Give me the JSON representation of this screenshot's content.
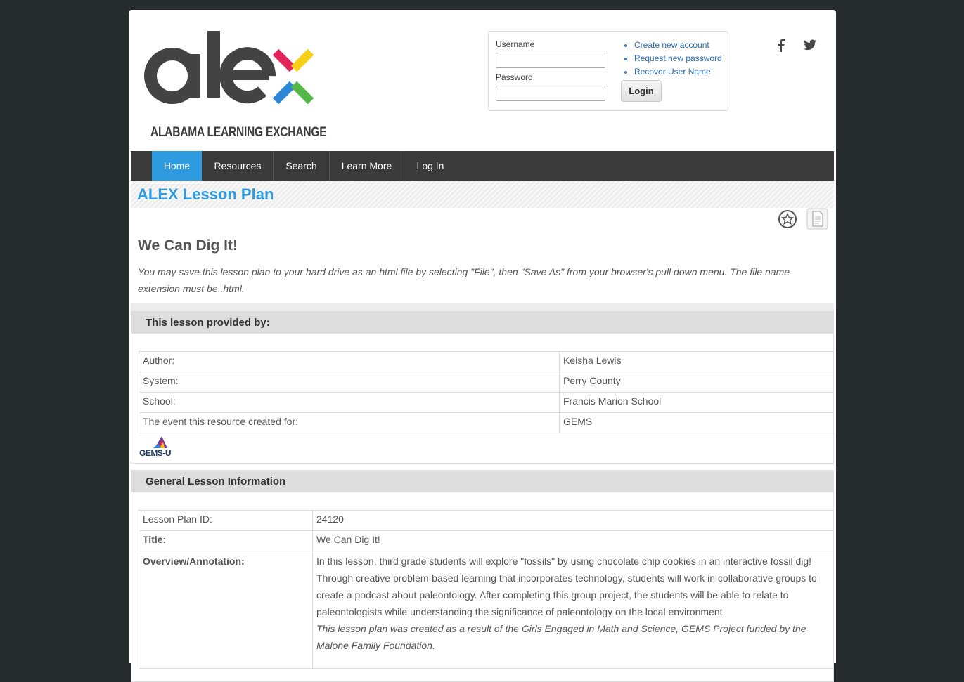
{
  "header": {
    "logo_tagline": "ALABAMA LEARNING EXCHANGE",
    "logo_word": "alex"
  },
  "login": {
    "username_label": "Username",
    "password_label": "Password",
    "username_value": "",
    "password_value": "",
    "login_button": "Login",
    "links": [
      "Create new account",
      "Request new password",
      "Recover User Name"
    ]
  },
  "social": {
    "facebook": "f",
    "twitter": "twitter-icon"
  },
  "nav": {
    "items": [
      "Home",
      "Resources",
      "Search",
      "Learn More",
      "Log In"
    ],
    "active": "Home"
  },
  "section": {
    "title": "ALEX Lesson Plan"
  },
  "lesson": {
    "title": "We Can Dig It!",
    "save_note": "You may save this lesson plan to your hard drive as an html file by selecting \"File\", then \"Save As\" from your browser's pull down menu. The file name extension must be .html."
  },
  "provided_by": {
    "heading": "This lesson provided by:",
    "rows": [
      {
        "label": "Author:",
        "value": "Keisha Lewis"
      },
      {
        "label": "System:",
        "value": "Perry County"
      },
      {
        "label": "School:",
        "value": "Francis Marion School"
      },
      {
        "label": "The event this resource created for:",
        "value": "GEMS"
      }
    ],
    "badge": "GEMS-U"
  },
  "general": {
    "heading": "General Lesson Information",
    "id_label": "Lesson Plan ID:",
    "id_value": "24120",
    "title_label": "Title:",
    "title_value": "We Can Dig It!",
    "overview_label": "Overview/Annotation:",
    "overview_value": "In this lesson, third grade students will explore \"fossils\" by using chocolate chip cookies in an interactive fossil dig! Through creative problem-based learning that incorporates technology, students will work in collaborative groups to create a podcast about paleontology. After completing this group project, the students will be able to relate to paleontologists while understanding the significance of paleontology on the local environment.",
    "overview_note": "This lesson plan was created as a result of the Girls Engaged in Math and Science, GEMS Project funded by the Malone Family Foundation."
  },
  "colors": {
    "accent": "#2e9be0",
    "nav_bg": "#3a3a3a",
    "page_bg": "#262b2e"
  }
}
